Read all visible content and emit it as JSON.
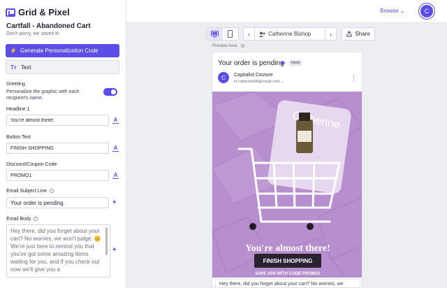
{
  "app": {
    "brand": "Grid & Pixel"
  },
  "topbar": {
    "browse_label": "Browse",
    "avatar_letter": "C"
  },
  "sidebar": {
    "campaign_title": "Cartfall - Abandoned Cart",
    "campaign_subtitle": "Don't worry, we saved it!",
    "generate_label": "Generate Personalization Code",
    "text_tab_icon": "Tт",
    "text_tab_label": "Text",
    "greeting": {
      "label": "Greeting",
      "description": "Personalize the graphic with each recipient's name.",
      "enabled": true
    },
    "fields": {
      "headline1_label": "Headline 1",
      "headline1_value": "You're almost there!",
      "button_text_label": "Button Text",
      "button_text_value": "FINISH SHOPPING",
      "coupon_label": "Discount/Coupon Code",
      "coupon_value": "PROMO1",
      "subject_label": "Email Subject Line",
      "subject_value": "Your order is pending",
      "body_label": "Email Body",
      "body_value": "Hey there, did you forget about your cart? No worries, we won't judge. 😊 We're just here to remind you that you've got some amazing items waiting for you, and if you check out now we'll give you a"
    }
  },
  "toolbar": {
    "recipient_name": "Catherine Bishop",
    "share_label": "Share",
    "preview_label": "Preview Area"
  },
  "email": {
    "subject": "Your order is pending",
    "inbox_tag": "Inbox",
    "sender_initial": "C",
    "sender_name": "Capitalist Couture",
    "sender_to": "to catherine96@email.com",
    "hero": {
      "name": "Catherine",
      "headline": "You're almost there!",
      "button": "FINISH SHOPPING",
      "promo": "SAVE 10% WITH CODE PROMO1"
    },
    "snippet": "Hey there, did you forget about your cart? No worries, we"
  },
  "colors": {
    "accent": "#5b4ee8",
    "hero_bg": "#b78fce"
  },
  "icons": [
    "logo-icon",
    "wand-icon",
    "text-icon",
    "info-icon",
    "desktop-icon",
    "mobile-icon",
    "chevron-left-icon",
    "chevron-right-icon",
    "user-icon",
    "share-icon",
    "chevron-down-icon",
    "kebab-icon"
  ]
}
